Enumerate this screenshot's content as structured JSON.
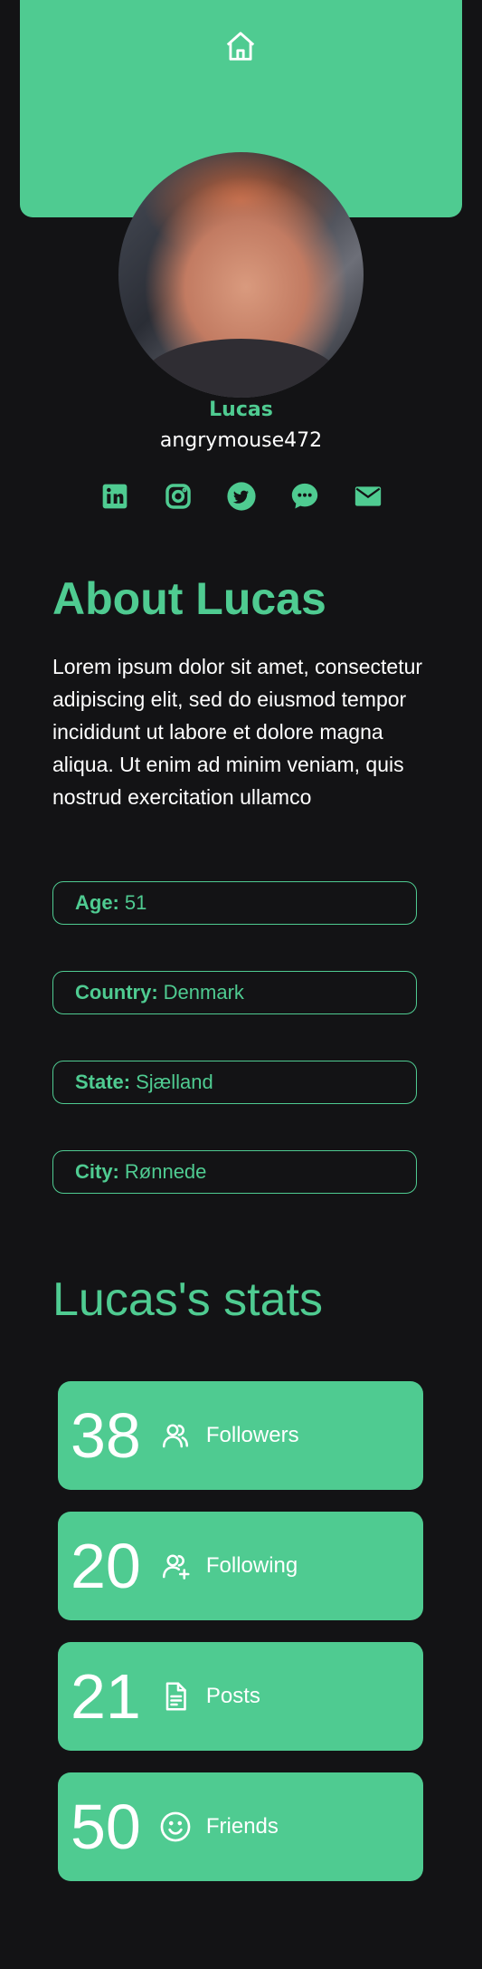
{
  "profile": {
    "first_name": "Lucas",
    "handle": "angrymouse472"
  },
  "header": {
    "home_icon": "home-icon"
  },
  "socials": [
    {
      "icon": "linkedin-icon"
    },
    {
      "icon": "instagram-icon"
    },
    {
      "icon": "twitter-icon"
    },
    {
      "icon": "chat-icon"
    },
    {
      "icon": "mail-icon"
    }
  ],
  "about": {
    "title": "About Lucas",
    "text": "Lorem ipsum dolor sit amet, consectetur adipiscing elit, sed do eiusmod tempor incididunt ut labore et dolore magna aliqua. Ut enim ad minim veniam, quis nostrud exercitation ullamco"
  },
  "info": [
    {
      "label": "Age:",
      "value": "51"
    },
    {
      "label": "Country:",
      "value": "Denmark"
    },
    {
      "label": "State:",
      "value": "Sjælland"
    },
    {
      "label": "City:",
      "value": "Rønnede"
    }
  ],
  "stats": {
    "title": "Lucas's stats",
    "items": [
      {
        "value": "38",
        "label": "Followers",
        "icon": "users-icon"
      },
      {
        "value": "20",
        "label": "Following",
        "icon": "user-add-icon"
      },
      {
        "value": "21",
        "label": "Posts",
        "icon": "document-icon"
      },
      {
        "value": "50",
        "label": "Friends",
        "icon": "smile-icon"
      }
    ]
  },
  "colors": {
    "accent": "#4fcb91",
    "background": "#131315",
    "text": "#ffffff"
  }
}
